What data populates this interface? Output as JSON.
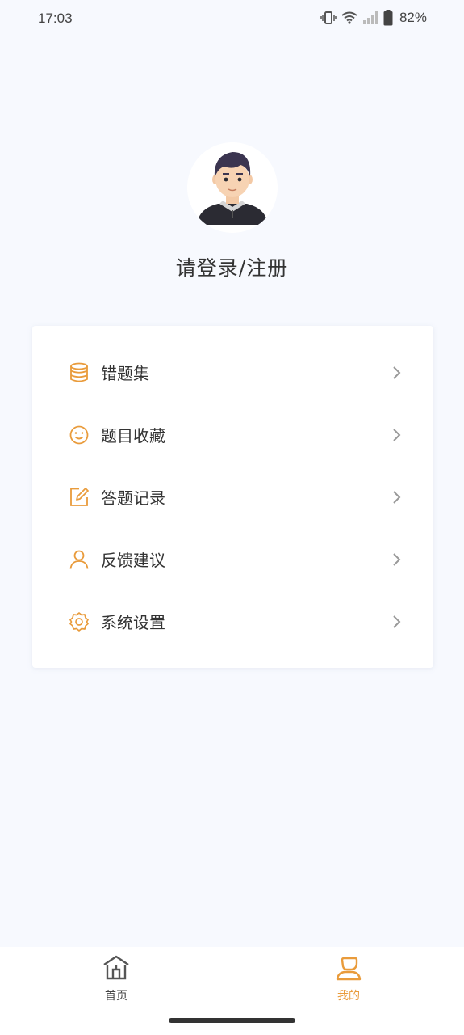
{
  "status_bar": {
    "time": "17:03",
    "battery": "82%",
    "icons": [
      "vibrate-icon",
      "wifi-icon",
      "signal-icon",
      "battery-icon"
    ]
  },
  "profile": {
    "login_text": "请登录/注册"
  },
  "menu": {
    "items": [
      {
        "label": "错题集",
        "icon": "database-icon"
      },
      {
        "label": "题目收藏",
        "icon": "smiley-icon"
      },
      {
        "label": "答题记录",
        "icon": "edit-icon"
      },
      {
        "label": "反馈建议",
        "icon": "person-icon"
      },
      {
        "label": "系统设置",
        "icon": "gear-icon"
      }
    ]
  },
  "bottom_nav": {
    "home_label": "首页",
    "me_label": "我的"
  },
  "colors": {
    "accent": "#e99b3b",
    "background": "#f7f9fe",
    "inactive": "#555555"
  }
}
